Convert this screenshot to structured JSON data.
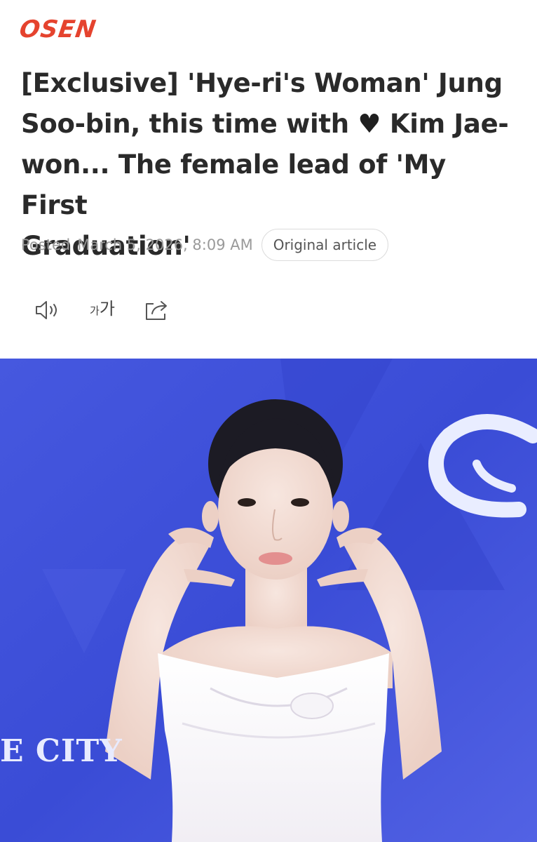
{
  "header": {
    "logo_text": "OSEN"
  },
  "article": {
    "title_line1": "[Exclusive] 'Hye-ri's Woman' Jung",
    "title_line2_a": "Soo-bin, this time with ",
    "title_heart": "♥",
    "title_line2_b": " Kim Jae-",
    "title_line3": "won... The female lead of 'My First",
    "title_line4": "Graduation'",
    "posted_label": "Posted",
    "posted_date": "March 5, 2026, 8:09 AM",
    "original_article_label": "Original article"
  },
  "tools": {
    "font_size_small": "가",
    "font_size_large": "가"
  },
  "photo": {
    "backdrop_text": "E CITY"
  },
  "colors": {
    "brand": "#e5432e",
    "backdrop_blue": "#3f50d9"
  }
}
